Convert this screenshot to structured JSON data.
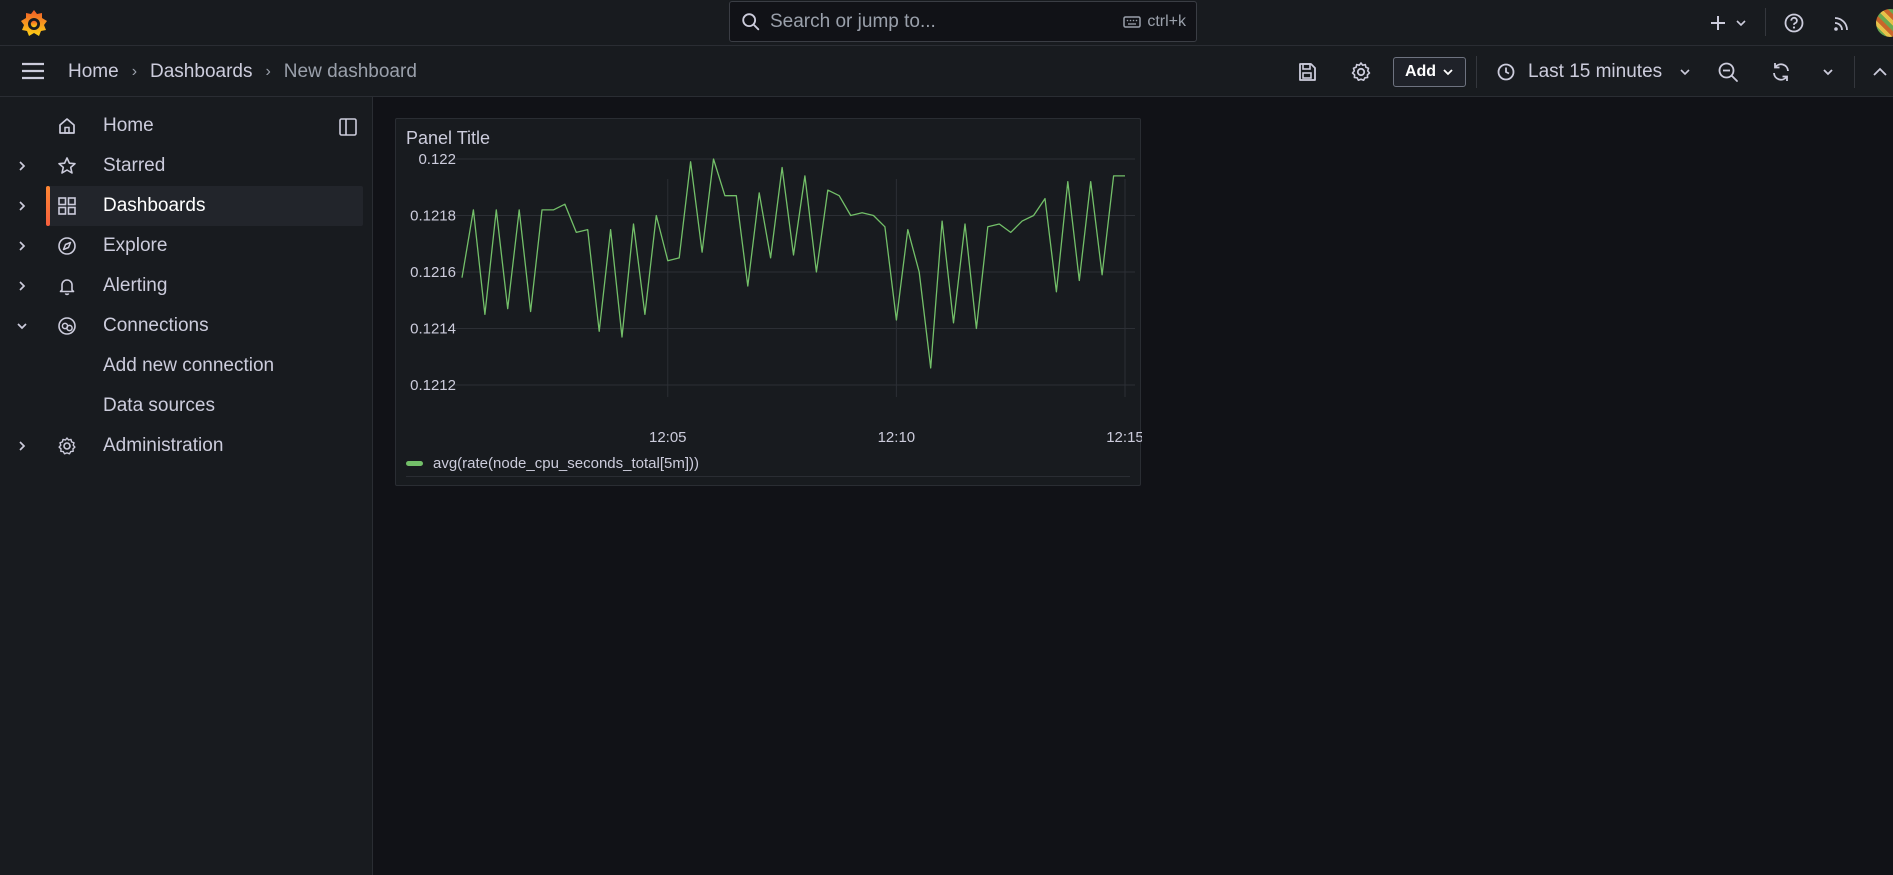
{
  "topbar": {
    "search_placeholder": "Search or jump to...",
    "shortcut": "ctrl+k",
    "icons": [
      "grafana-logo-icon",
      "plus-icon",
      "help-icon",
      "news-icon",
      "avatar"
    ]
  },
  "breadcrumb": [
    "Home",
    "Dashboards",
    "New dashboard"
  ],
  "toolbar": {
    "add_label": "Add",
    "time_range": "Last 15 minutes"
  },
  "sidebar": {
    "items": [
      {
        "label": "Home",
        "icon": "home-icon"
      },
      {
        "label": "Starred",
        "icon": "star-icon"
      },
      {
        "label": "Dashboards",
        "icon": "apps-icon",
        "active": true
      },
      {
        "label": "Explore",
        "icon": "compass-icon"
      },
      {
        "label": "Alerting",
        "icon": "bell-icon"
      },
      {
        "label": "Connections",
        "icon": "connections-icon",
        "expanded": true
      },
      {
        "label": "Administration",
        "icon": "cog-icon"
      }
    ],
    "sub_items": [
      "Add new connection",
      "Data sources"
    ]
  },
  "panel": {
    "title": "Panel Title"
  },
  "colors": {
    "series": "#73bf69",
    "accent": "#f55f3e",
    "background": "#111217",
    "panel": "#181b1f"
  },
  "chart_data": {
    "type": "line",
    "title": "Panel Title",
    "x_tick_labels": [
      "12:05",
      "12:10",
      "12:15"
    ],
    "y_tick_labels": [
      "0.122",
      "0.1218",
      "0.1216",
      "0.1214",
      "0.1212"
    ],
    "ylim": [
      0.1212,
      0.122
    ],
    "grid": true,
    "legend": "bottom-left",
    "series": [
      {
        "name": "avg(rate(node_cpu_seconds_total[5m]))",
        "color": "#73bf69",
        "x": [
          "12:00:30",
          "12:00:45",
          "12:01:00",
          "12:01:15",
          "12:01:30",
          "12:01:45",
          "12:02:00",
          "12:02:15",
          "12:02:30",
          "12:02:45",
          "12:03:00",
          "12:03:15",
          "12:03:30",
          "12:03:45",
          "12:04:00",
          "12:04:15",
          "12:04:30",
          "12:04:45",
          "12:05:00",
          "12:05:15",
          "12:05:30",
          "12:05:45",
          "12:06:00",
          "12:06:15",
          "12:06:30",
          "12:06:45",
          "12:07:00",
          "12:07:15",
          "12:07:30",
          "12:07:45",
          "12:08:00",
          "12:08:15",
          "12:08:30",
          "12:08:45",
          "12:09:00",
          "12:09:15",
          "12:09:30",
          "12:09:45",
          "12:10:00",
          "12:10:15",
          "12:10:30",
          "12:10:45",
          "12:11:00",
          "12:11:15",
          "12:11:30",
          "12:11:45",
          "12:12:00",
          "12:12:15",
          "12:12:30",
          "12:12:45",
          "12:13:00",
          "12:13:15",
          "12:13:30",
          "12:13:45",
          "12:14:00",
          "12:14:15",
          "12:14:30",
          "12:14:45",
          "12:15:00"
        ],
        "values": [
          0.12158,
          0.12182,
          0.12145,
          0.12182,
          0.12147,
          0.12182,
          0.12146,
          0.12182,
          0.12182,
          0.12184,
          0.12174,
          0.12175,
          0.12139,
          0.12175,
          0.12137,
          0.12177,
          0.12145,
          0.1218,
          0.12164,
          0.12165,
          0.12199,
          0.12167,
          0.122,
          0.12187,
          0.12187,
          0.12155,
          0.12188,
          0.12165,
          0.12197,
          0.12166,
          0.12194,
          0.1216,
          0.12189,
          0.12187,
          0.1218,
          0.12181,
          0.1218,
          0.12176,
          0.12143,
          0.12175,
          0.1216,
          0.12126,
          0.12178,
          0.12142,
          0.12177,
          0.1214,
          0.12176,
          0.12177,
          0.12174,
          0.12178,
          0.1218,
          0.12186,
          0.12153,
          0.12192,
          0.12157,
          0.12192,
          0.12159,
          0.12194,
          0.12194
        ]
      }
    ]
  }
}
